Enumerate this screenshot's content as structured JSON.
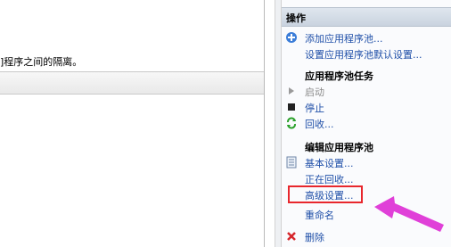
{
  "main": {
    "description": "]程序之间的隔离。"
  },
  "actions": {
    "title": "操作",
    "items": [
      {
        "label": "添加应用程序池...",
        "icon": "add-pool-icon",
        "type": "link"
      },
      {
        "label": "设置应用程序池默认设置...",
        "icon": "",
        "type": "link"
      }
    ],
    "section_tasks": "应用程序池任务",
    "tasks": [
      {
        "label": "启动",
        "icon": "play-icon",
        "type": "disabled"
      },
      {
        "label": "停止",
        "icon": "stop-icon",
        "type": "link"
      },
      {
        "label": "回收...",
        "icon": "recycle-icon",
        "type": "link"
      }
    ],
    "section_edit": "编辑应用程序池",
    "edit": [
      {
        "label": "基本设置...",
        "icon": "settings-icon",
        "type": "link"
      },
      {
        "label": "正在回收...",
        "icon": "",
        "type": "link"
      },
      {
        "label": "高级设置...",
        "icon": "",
        "type": "link"
      },
      {
        "label": "重命名",
        "icon": "",
        "type": "link"
      }
    ],
    "delete_label": "删除"
  },
  "colors": {
    "link": "#1f4fa8",
    "highlight_box": "#e8272d",
    "arrow": "#e040d8"
  }
}
